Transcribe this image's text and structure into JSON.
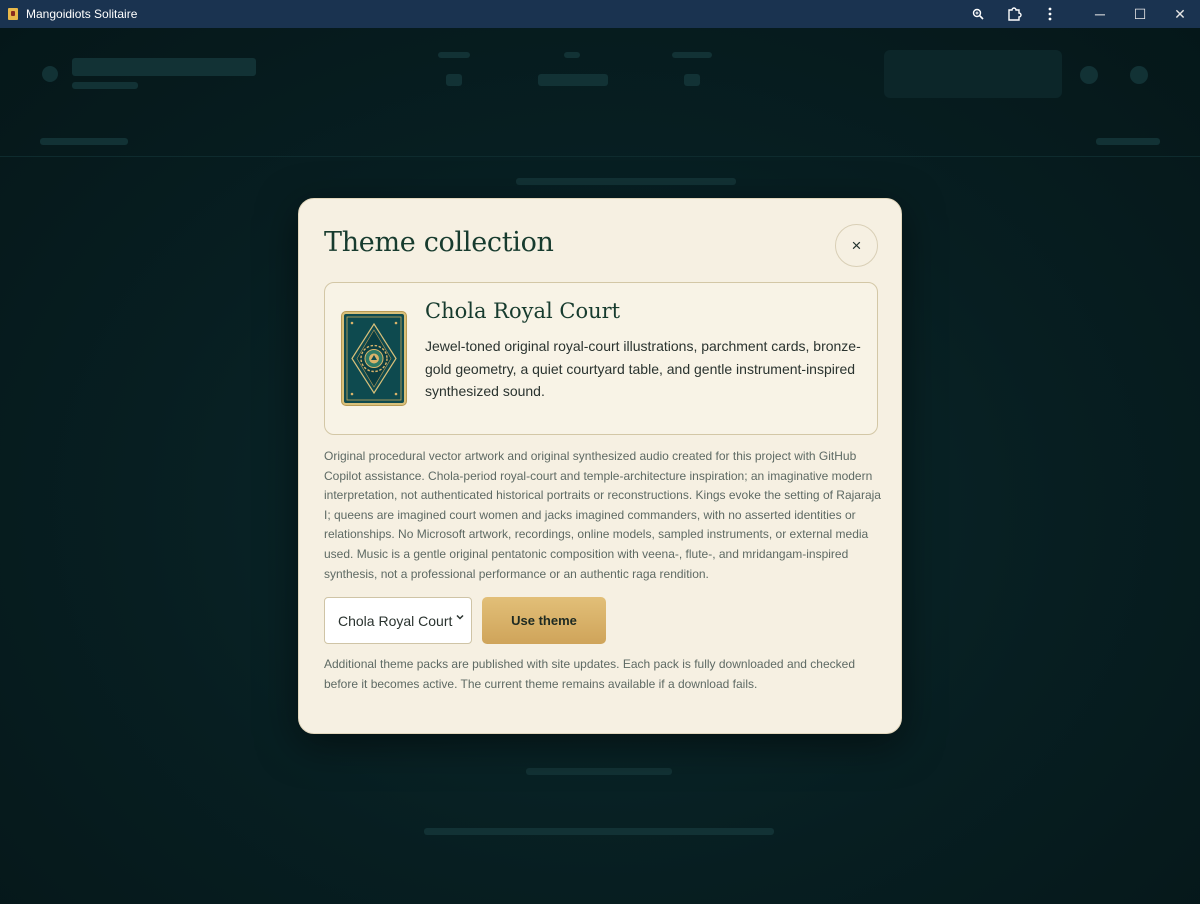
{
  "window": {
    "title": "Mangoidiots Solitaire",
    "icons": [
      "zoom-icon",
      "extensions-icon",
      "more-icon"
    ],
    "controls": {
      "minimize": "─",
      "maximize": "☐",
      "close": "✕"
    }
  },
  "modal": {
    "title": "Theme collection",
    "close_label": "×",
    "theme": {
      "name": "Chola Royal Court",
      "description": "Jewel-toned original royal-court illustrations, parchment cards, bronze-gold geometry, a quiet courtyard table, and gentle instrument-inspired synthesized sound."
    },
    "credits": "Original procedural vector artwork and original synthesized audio created for this project with GitHub Copilot assistance. Chola-period royal-court and temple-architecture inspiration; an imaginative modern interpretation, not authenticated historical portraits or reconstructions. Kings evoke the setting of Rajaraja I; queens are imagined court women and jacks imagined commanders, with no asserted identities or relationships. No Microsoft artwork, recordings, online models, sampled instruments, or external media used. Music is a gentle original pentatonic composition with veena-, flute-, and mridangam-inspired synthesis, not a professional performance or an authentic raga rendition.",
    "select": {
      "value": "Chola Royal Court"
    },
    "use_button": "Use theme",
    "footnote": "Additional theme packs are published with site updates. Each pack is fully downloaded and checked before it becomes active. The current theme remains available if a download fails."
  },
  "colors": {
    "titlebar": "#1a3350",
    "backdrop": "#061c1f",
    "modal_bg": "#f6f0e2",
    "accent_gold": "#d9b36a",
    "heading_green": "#173b2e",
    "card_teal": "#0e4a4f"
  }
}
